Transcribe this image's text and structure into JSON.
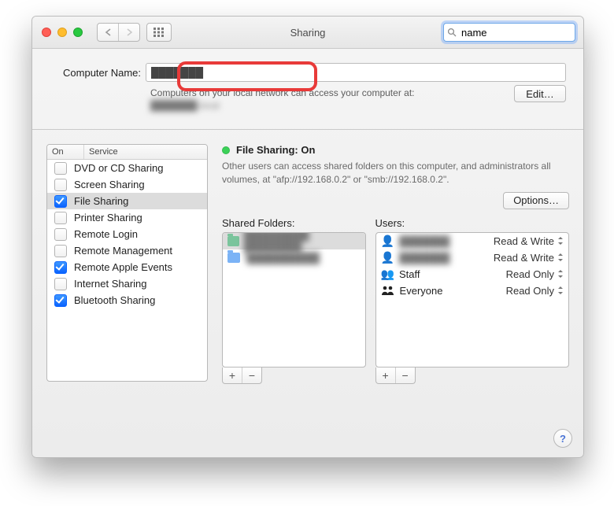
{
  "toolbar": {
    "title": "Sharing",
    "search_value": "name"
  },
  "computer": {
    "label": "Computer Name:",
    "value": "███████",
    "info_prefix": "Computers on your local network can access your computer at:",
    "hostname": "███████.local",
    "edit_label": "Edit…"
  },
  "services": {
    "header_on": "On",
    "header_service": "Service",
    "items": [
      {
        "on": false,
        "label": "DVD or CD Sharing",
        "selected": false
      },
      {
        "on": false,
        "label": "Screen Sharing",
        "selected": false
      },
      {
        "on": true,
        "label": "File Sharing",
        "selected": true
      },
      {
        "on": false,
        "label": "Printer Sharing",
        "selected": false
      },
      {
        "on": false,
        "label": "Remote Login",
        "selected": false
      },
      {
        "on": false,
        "label": "Remote Management",
        "selected": false
      },
      {
        "on": true,
        "label": "Remote Apple Events",
        "selected": false
      },
      {
        "on": false,
        "label": "Internet Sharing",
        "selected": false
      },
      {
        "on": true,
        "label": "Bluetooth Sharing",
        "selected": false
      }
    ]
  },
  "detail": {
    "status_label": "File Sharing: On",
    "description": "Other users can access shared folders on this computer, and administrators all volumes, at \"afp://192.168.0.2\" or \"smb://192.168.0.2\".",
    "options_label": "Options…",
    "shared_title": "Shared Folders:",
    "users_title": "Users:",
    "shared_folders": [
      {
        "name": "█████████ ████████",
        "selected": true,
        "icon": "pub"
      },
      {
        "name": "i██████████",
        "selected": false,
        "icon": "folder"
      }
    ],
    "users": [
      {
        "name": "███████",
        "perm": "Read & Write",
        "icon": "person"
      },
      {
        "name": "███████",
        "perm": "Read & Write",
        "icon": "person"
      },
      {
        "name": "Staff",
        "perm": "Read Only",
        "icon": "pair"
      },
      {
        "name": "Everyone",
        "perm": "Read Only",
        "icon": "group"
      }
    ]
  },
  "glyph": {
    "plus": "+",
    "minus": "−",
    "help": "?"
  }
}
